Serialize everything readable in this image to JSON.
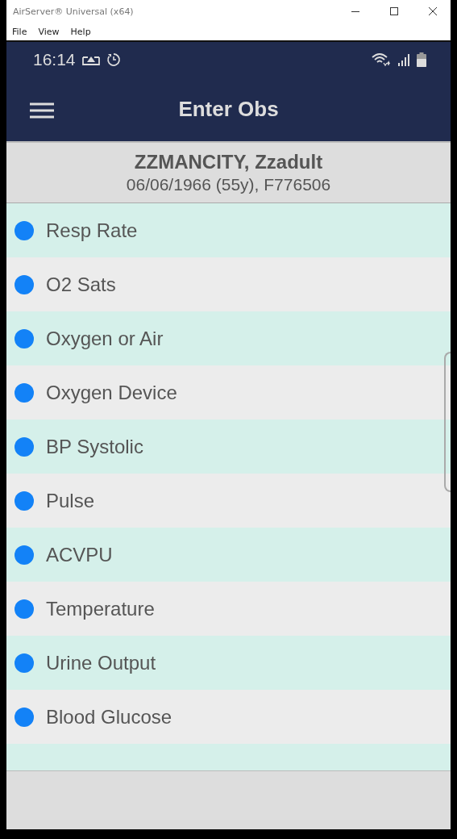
{
  "window": {
    "title": "AirServer® Universal (x64)"
  },
  "menu": [
    "File",
    "View",
    "Help"
  ],
  "status_bar": {
    "time": "16:14"
  },
  "app_bar": {
    "title": "Enter Obs"
  },
  "patient": {
    "name": "ZZMANCITY, Zzadult",
    "details": "06/06/1966 (55y), F776506"
  },
  "observations": [
    {
      "label": "Resp Rate"
    },
    {
      "label": "O2 Sats"
    },
    {
      "label": "Oxygen or Air"
    },
    {
      "label": "Oxygen Device"
    },
    {
      "label": "BP Systolic"
    },
    {
      "label": "Pulse"
    },
    {
      "label": "ACVPU"
    },
    {
      "label": "Temperature"
    },
    {
      "label": "Urine Output"
    },
    {
      "label": "Blood Glucose"
    }
  ]
}
